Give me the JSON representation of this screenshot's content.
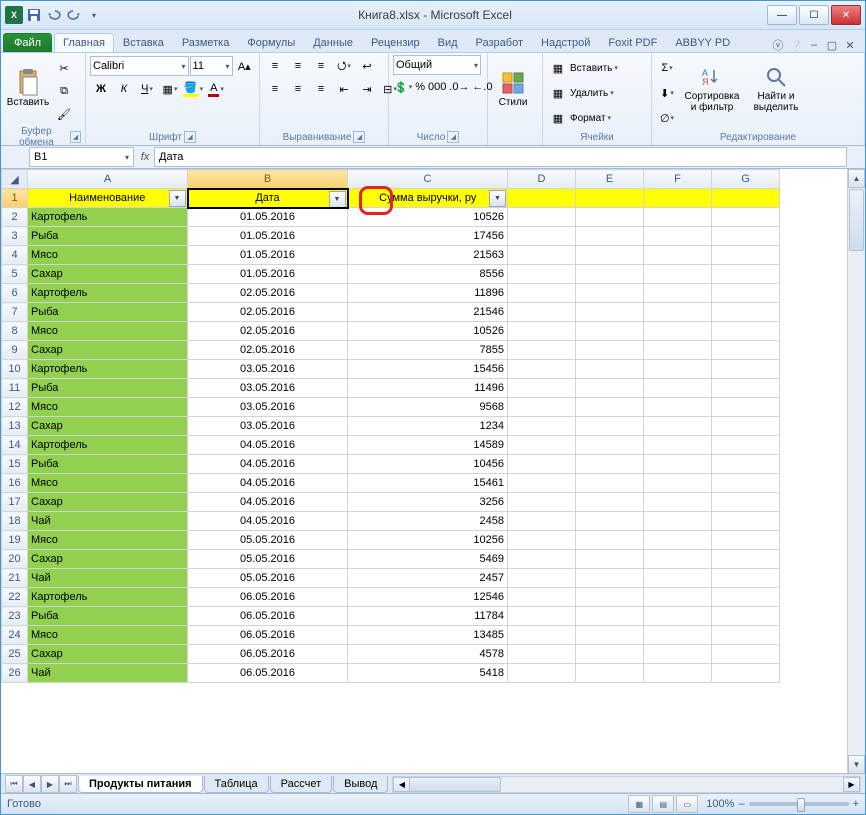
{
  "title": "Книга8.xlsx - Microsoft Excel",
  "tabs": {
    "file": "Файл",
    "home": "Главная",
    "insert": "Вставка",
    "layout": "Разметка",
    "formulas": "Формулы",
    "data": "Данные",
    "review": "Рецензир",
    "view": "Вид",
    "dev": "Разработ",
    "addins": "Надстрой",
    "foxit": "Foxit PDF",
    "abbyy": "ABBYY PD"
  },
  "ribbon": {
    "clipboard": {
      "paste": "Вставить",
      "label": "Буфер обмена"
    },
    "font": {
      "name": "Calibri",
      "size": "11",
      "label": "Шрифт"
    },
    "align": {
      "label": "Выравнивание"
    },
    "number": {
      "format": "Общий",
      "label": "Число"
    },
    "styles": {
      "btn": "Стили"
    },
    "cells": {
      "insert": "Вставить",
      "delete": "Удалить",
      "format": "Формат",
      "label": "Ячейки"
    },
    "editing": {
      "sort": "Сортировка и фильтр",
      "find": "Найти и выделить",
      "label": "Редактирование"
    }
  },
  "namebox": "B1",
  "formula": "Дата",
  "columns": [
    "A",
    "B",
    "C",
    "D",
    "E",
    "F",
    "G"
  ],
  "headers": {
    "a": "Наименование",
    "b": "Дата",
    "c": "Сумма выручки, ру"
  },
  "rows": [
    {
      "n": 2,
      "name": "Картофель",
      "date": "01.05.2016",
      "sum": "10526"
    },
    {
      "n": 3,
      "name": "Рыба",
      "date": "01.05.2016",
      "sum": "17456"
    },
    {
      "n": 4,
      "name": "Мясо",
      "date": "01.05.2016",
      "sum": "21563"
    },
    {
      "n": 5,
      "name": "Сахар",
      "date": "01.05.2016",
      "sum": "8556"
    },
    {
      "n": 6,
      "name": "Картофель",
      "date": "02.05.2016",
      "sum": "11896"
    },
    {
      "n": 7,
      "name": "Рыба",
      "date": "02.05.2016",
      "sum": "21546"
    },
    {
      "n": 8,
      "name": "Мясо",
      "date": "02.05.2016",
      "sum": "10526"
    },
    {
      "n": 9,
      "name": "Сахар",
      "date": "02.05.2016",
      "sum": "7855"
    },
    {
      "n": 10,
      "name": "Картофель",
      "date": "03.05.2016",
      "sum": "15456"
    },
    {
      "n": 11,
      "name": "Рыба",
      "date": "03.05.2016",
      "sum": "11496"
    },
    {
      "n": 12,
      "name": "Мясо",
      "date": "03.05.2016",
      "sum": "9568"
    },
    {
      "n": 13,
      "name": "Сахар",
      "date": "03.05.2016",
      "sum": "1234"
    },
    {
      "n": 14,
      "name": "Картофель",
      "date": "04.05.2016",
      "sum": "14589"
    },
    {
      "n": 15,
      "name": "Рыба",
      "date": "04.05.2016",
      "sum": "10456"
    },
    {
      "n": 16,
      "name": "Мясо",
      "date": "04.05.2016",
      "sum": "15461"
    },
    {
      "n": 17,
      "name": "Сахар",
      "date": "04.05.2016",
      "sum": "3256"
    },
    {
      "n": 18,
      "name": "Чай",
      "date": "04.05.2016",
      "sum": "2458"
    },
    {
      "n": 19,
      "name": "Мясо",
      "date": "05.05.2016",
      "sum": "10256"
    },
    {
      "n": 20,
      "name": "Сахар",
      "date": "05.05.2016",
      "sum": "5469"
    },
    {
      "n": 21,
      "name": "Чай",
      "date": "05.05.2016",
      "sum": "2457"
    },
    {
      "n": 22,
      "name": "Картофель",
      "date": "06.05.2016",
      "sum": "12546"
    },
    {
      "n": 23,
      "name": "Рыба",
      "date": "06.05.2016",
      "sum": "11784"
    },
    {
      "n": 24,
      "name": "Мясо",
      "date": "06.05.2016",
      "sum": "13485"
    },
    {
      "n": 25,
      "name": "Сахар",
      "date": "06.05.2016",
      "sum": "4578"
    },
    {
      "n": 26,
      "name": "Чай",
      "date": "06.05.2016",
      "sum": "5418"
    }
  ],
  "sheets": {
    "s1": "Продукты питания",
    "s2": "Таблица",
    "s3": "Рассчет",
    "s4": "Вывод"
  },
  "status": {
    "ready": "Готово",
    "zoom": "100%"
  }
}
